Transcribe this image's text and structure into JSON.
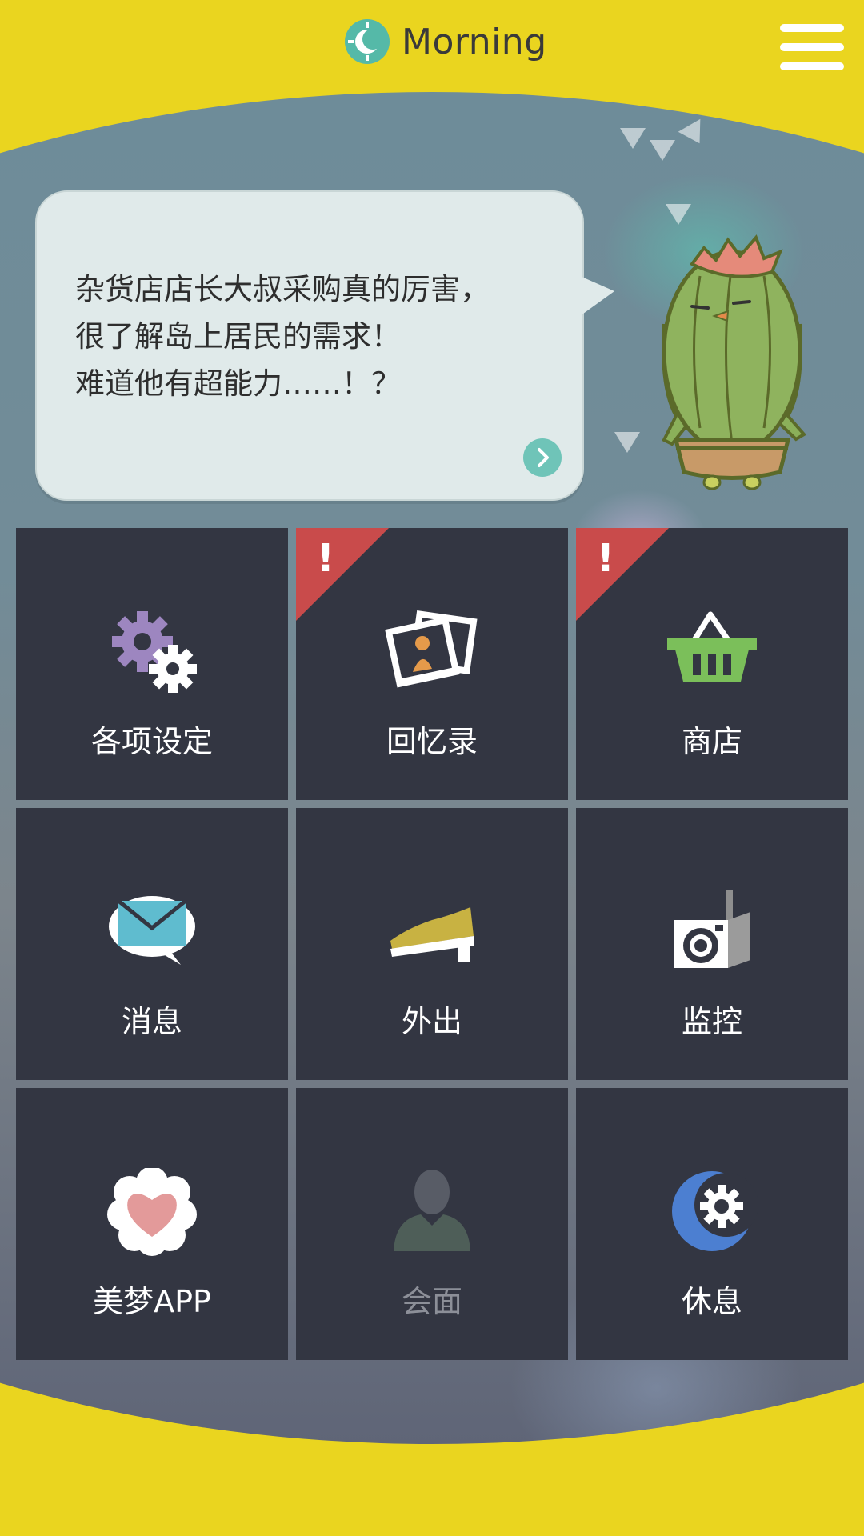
{
  "header": {
    "title": "Morning",
    "time_icon": "sun-moon-icon",
    "menu_icon": "hamburger-menu-icon"
  },
  "bubble": {
    "lines": [
      "杂货店店长大叔采购真的厉害，",
      "很了解岛上居民的需求！",
      "难道他有超能力……！？"
    ],
    "next_icon": "chevron-right-icon"
  },
  "menu_tiles": [
    {
      "label": "各项设定",
      "icon": "gears-icon",
      "alert": false
    },
    {
      "label": "回忆录",
      "icon": "photos-icon",
      "alert": true,
      "alert_mark": "!"
    },
    {
      "label": "商店",
      "icon": "basket-icon",
      "alert": true,
      "alert_mark": "!"
    },
    {
      "label": "消息",
      "icon": "mail-bubble-icon",
      "alert": false
    },
    {
      "label": "外出",
      "icon": "shoe-icon",
      "alert": false
    },
    {
      "label": "监控",
      "icon": "camera-icon",
      "alert": false
    },
    {
      "label": "美梦APP",
      "icon": "heart-flower-icon",
      "alert": false
    },
    {
      "label": "会面",
      "icon": "person-icon",
      "alert": false,
      "disabled": true
    },
    {
      "label": "休息",
      "icon": "moon-gear-icon",
      "alert": false
    }
  ],
  "colors": {
    "top_bar": "#ead51f",
    "tile_bg": "#333642",
    "alert_badge": "#c94b4b",
    "accent_teal": "#55b9a8"
  }
}
